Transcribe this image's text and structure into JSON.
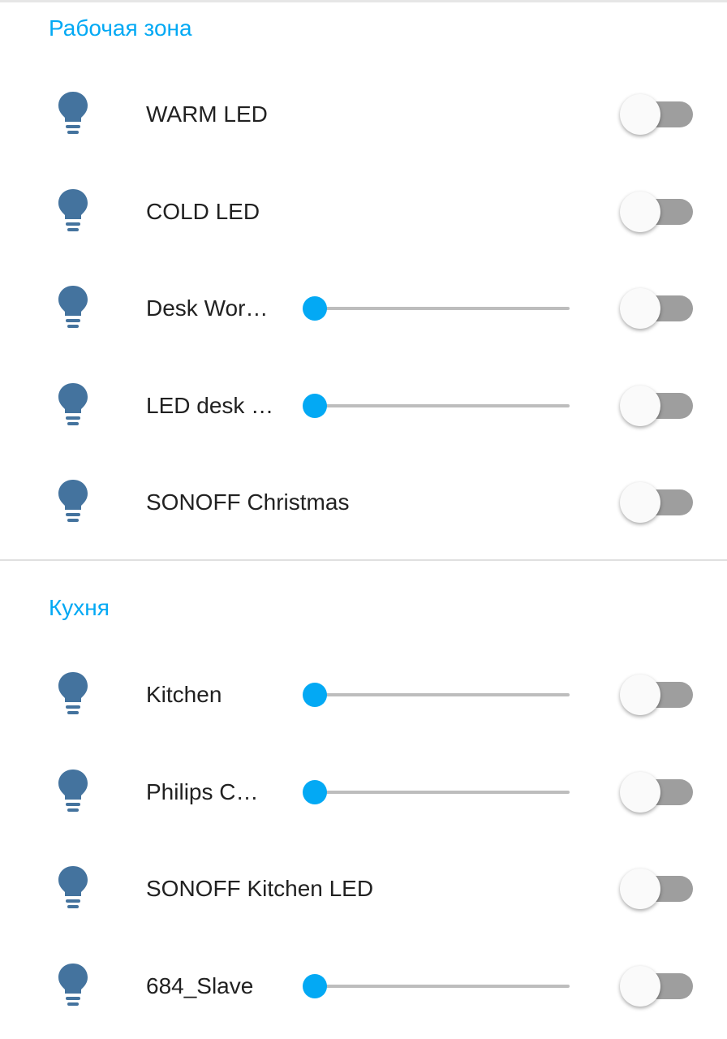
{
  "colors": {
    "accent": "#03a9f4",
    "icon": "#44739e",
    "toggle_track_off": "#9e9e9e",
    "toggle_thumb_off": "#fafafa",
    "slider_track": "#bdbdbd",
    "divider": "#e0e0e0"
  },
  "sections": [
    {
      "title": "Рабочая зона",
      "rows": [
        {
          "icon": "lightbulb-icon",
          "label": "WARM LED",
          "has_slider": false,
          "toggle_on": false
        },
        {
          "icon": "lightbulb-icon",
          "label": "COLD LED",
          "has_slider": false,
          "toggle_on": false
        },
        {
          "icon": "lightbulb-icon",
          "label": "Desk Wor…",
          "has_slider": true,
          "slider_value": 0,
          "toggle_on": false
        },
        {
          "icon": "lightbulb-icon",
          "label": "LED desk …",
          "has_slider": true,
          "slider_value": 0,
          "toggle_on": false
        },
        {
          "icon": "lightbulb-icon",
          "label": "SONOFF Christmas",
          "has_slider": false,
          "toggle_on": false
        }
      ]
    },
    {
      "title": "Кухня",
      "rows": [
        {
          "icon": "lightbulb-icon",
          "label": "Kitchen",
          "has_slider": true,
          "slider_value": 0,
          "toggle_on": false
        },
        {
          "icon": "lightbulb-icon",
          "label": "Philips C…",
          "has_slider": true,
          "slider_value": 0,
          "toggle_on": false
        },
        {
          "icon": "lightbulb-icon",
          "label": "SONOFF Kitchen LED",
          "has_slider": false,
          "toggle_on": false
        },
        {
          "icon": "lightbulb-icon",
          "label": "684_Slave",
          "has_slider": true,
          "slider_value": 0,
          "toggle_on": false
        }
      ]
    }
  ]
}
